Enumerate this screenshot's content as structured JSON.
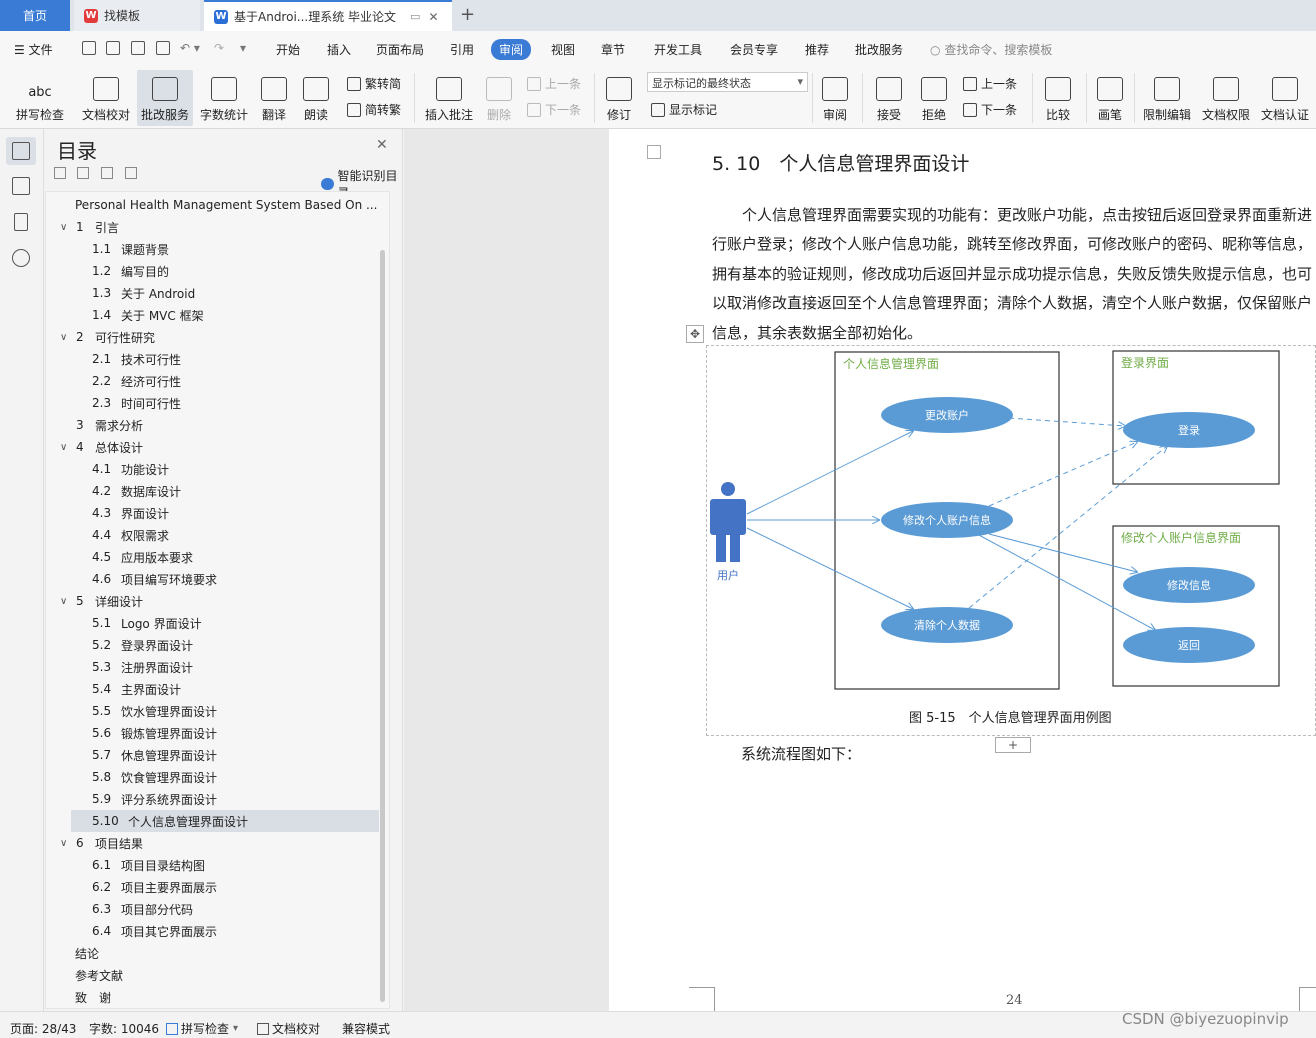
{
  "tabs": [
    {
      "label": "首页"
    },
    {
      "label": "找模板"
    },
    {
      "label": "基于Androi...理系统 毕业论文"
    }
  ],
  "menu": {
    "file": "文件",
    "items": [
      "开始",
      "插入",
      "页面布局",
      "引用",
      "审阅",
      "视图",
      "章节",
      "开发工具",
      "会员专享",
      "推荐",
      "批改服务"
    ],
    "active": "审阅",
    "search_placeholder": "查找命令、搜索模板"
  },
  "ribbon": {
    "spell_check": "拼写检查",
    "doc_proof": "文档校对",
    "review_service": "批改服务",
    "word_count": "字数统计",
    "translate": "翻译",
    "read_aloud": "朗读",
    "trad_to_simp": "繁转简",
    "simp_to_trad": "简转繁",
    "insert_comment": "插入批注",
    "delete": "删除",
    "prev": "上一条",
    "next": "下一条",
    "revise": "修订",
    "markup_combo": "显示标记的最终状态",
    "show_markup": "显示标记",
    "review": "审阅",
    "accept": "接受",
    "reject": "拒绝",
    "prev2": "上一条",
    "next2": "下一条",
    "compare": "比较",
    "pen": "画笔",
    "restrict_edit": "限制编辑",
    "doc_permission": "文档权限",
    "doc_certify": "文档认证"
  },
  "toc": {
    "title": "目录",
    "smart": "智能识别目录",
    "items": [
      {
        "num": "",
        "text": "Personal Health Management System Based On ...",
        "level": 0,
        "caret": false
      },
      {
        "num": "1",
        "text": "引言",
        "level": 1,
        "caret": true
      },
      {
        "num": "1.1",
        "text": "课题背景",
        "level": 2
      },
      {
        "num": "1.2",
        "text": "编写目的",
        "level": 2
      },
      {
        "num": "1.3",
        "text": "关于 Android",
        "level": 2
      },
      {
        "num": "1.4",
        "text": "关于 MVC 框架",
        "level": 2
      },
      {
        "num": "2",
        "text": "可行性研究",
        "level": 1,
        "caret": true
      },
      {
        "num": "2.1",
        "text": "技术可行性",
        "level": 2
      },
      {
        "num": "2.2",
        "text": "经济可行性",
        "level": 2
      },
      {
        "num": "2.3",
        "text": "时间可行性",
        "level": 2
      },
      {
        "num": "3",
        "text": "需求分析",
        "level": 1,
        "caret": false
      },
      {
        "num": "4",
        "text": "总体设计",
        "level": 1,
        "caret": true
      },
      {
        "num": "4.1",
        "text": "功能设计",
        "level": 2
      },
      {
        "num": "4.2",
        "text": "数据库设计",
        "level": 2
      },
      {
        "num": "4.3",
        "text": "界面设计",
        "level": 2
      },
      {
        "num": "4.4",
        "text": "权限需求",
        "level": 2
      },
      {
        "num": "4.5",
        "text": "应用版本要求",
        "level": 2
      },
      {
        "num": "4.6",
        "text": "项目编写环境要求",
        "level": 2
      },
      {
        "num": "5",
        "text": "详细设计",
        "level": 1,
        "caret": true
      },
      {
        "num": "5.1",
        "text": "Logo 界面设计",
        "level": 2
      },
      {
        "num": "5.2",
        "text": "登录界面设计",
        "level": 2
      },
      {
        "num": "5.3",
        "text": "注册界面设计",
        "level": 2
      },
      {
        "num": "5.4",
        "text": "主界面设计",
        "level": 2
      },
      {
        "num": "5.5",
        "text": "饮水管理界面设计",
        "level": 2
      },
      {
        "num": "5.6",
        "text": "锻炼管理界面设计",
        "level": 2
      },
      {
        "num": "5.7",
        "text": "休息管理界面设计",
        "level": 2
      },
      {
        "num": "5.8",
        "text": "饮食管理界面设计",
        "level": 2
      },
      {
        "num": "5.9",
        "text": "评分系统界面设计",
        "level": 2
      },
      {
        "num": "5.10",
        "text": "个人信息管理界面设计",
        "level": 2,
        "active": true
      },
      {
        "num": "6",
        "text": "项目结果",
        "level": 1,
        "caret": true
      },
      {
        "num": "6.1",
        "text": "项目目录结构图",
        "level": 2
      },
      {
        "num": "6.2",
        "text": "项目主要界面展示",
        "level": 2
      },
      {
        "num": "6.3",
        "text": "项目部分代码",
        "level": 2
      },
      {
        "num": "6.4",
        "text": "项目其它界面展示",
        "level": 2
      },
      {
        "num": "",
        "text": "结论",
        "level": 0
      },
      {
        "num": "",
        "text": "参考文献",
        "level": 0
      },
      {
        "num": "",
        "text": "致　谢",
        "level": 0
      }
    ]
  },
  "document": {
    "heading": "5. 10　个人信息管理界面设计",
    "paragraph": "个人信息管理界面需要实现的功能有：更改账户功能，点击按钮后返回登录界面重新进行账户登录；修改个人账户信息功能，跳转至修改界面，可修改账户的密码、昵称等信息，拥有基本的验证规则，修改成功后返回并显示成功提示信息，失败反馈失败提示信息，也可以取消修改直接返回至个人信息管理界面；清除个人数据，清空个人账户数据，仅保留账户信息，其余表数据全部初始化。",
    "diagram": {
      "box_main": "个人信息管理界面",
      "box_login": "登录界面",
      "box_modify": "修改个人账户信息界面",
      "uc_change_account": "更改账户",
      "uc_modify_info": "修改个人账户信息",
      "uc_clear_data": "清除个人数据",
      "uc_login": "登录",
      "uc_modify": "修改信息",
      "uc_back": "返回",
      "actor": "用户"
    },
    "caption": "图 5-15　个人信息管理界面用例图",
    "flow_text": "系统流程图如下：",
    "page_number": "24"
  },
  "status": {
    "page": "页面: 28/43",
    "words": "字数: 10046",
    "spell": "拼写检查",
    "proof": "文档校对",
    "compat": "兼容模式"
  },
  "watermark": "CSDN @biyezuopinvip",
  "colors": {
    "accent": "#3a7bd5",
    "usecase": "#5b9bd5",
    "actor": "#4472c4",
    "box_title": "#70ad47"
  }
}
